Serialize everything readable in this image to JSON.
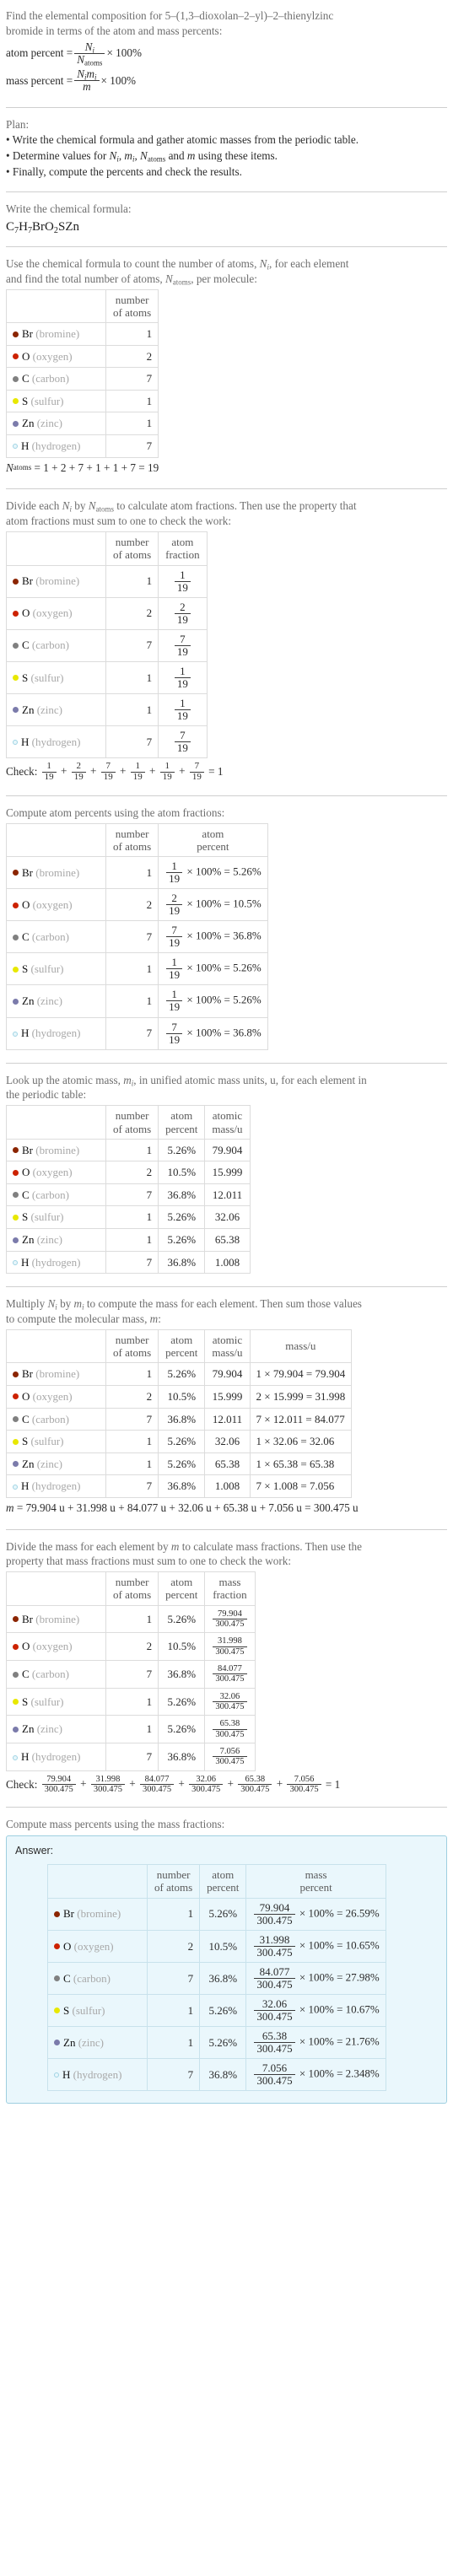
{
  "intro": {
    "line1": "Find the elemental composition for 5–(1,3–dioxolan–2–yl)–2–thienylzinc",
    "line2": "bromide in terms of the atom and mass percents:",
    "atom_percent_label": "atom percent =",
    "mass_percent_label": "mass percent =",
    "times100": "× 100%"
  },
  "plan": {
    "heading": "Plan:",
    "b1": "• Write the chemical formula and gather atomic masses from the periodic table.",
    "b2_pre": "• Determine values for ",
    "b2_post": " using these items.",
    "b3": "• Finally, compute the percents and check the results."
  },
  "formula_section": {
    "heading": "Write the chemical formula:",
    "formula": "C7H7BrO2SZn"
  },
  "count_section": {
    "line1": "Use the chemical formula to count the number of atoms, Ni, for each element",
    "line2": "and find the total number of atoms, Natoms, per molecule:",
    "headers": [
      "",
      "number of atoms"
    ],
    "total_line": "Natoms = 1 + 2 + 7 + 1 + 1 + 7 = 19",
    "total_sum": "1 + 2 + 7 + 1 + 1 + 7 = 19"
  },
  "fraction_section": {
    "line1": "Divide each Ni by Natoms to calculate atom fractions. Then use the property that",
    "line2": "atom fractions must sum to one to check the work:",
    "headers": [
      "",
      "number of atoms",
      "atom fraction"
    ],
    "check_label": "Check:",
    "check_result": "= 1"
  },
  "atom_percent_section": {
    "heading": "Compute atom percents using the atom fractions:",
    "headers": [
      "",
      "number of atoms",
      "atom percent"
    ]
  },
  "atomic_mass_section": {
    "line1": "Look up the atomic mass, mi, in unified atomic mass units, u, for each element in",
    "line2": "the periodic table:",
    "headers": [
      "",
      "number of atoms",
      "atom percent",
      "atomic mass/u"
    ]
  },
  "mass_section": {
    "line1": "Multiply Ni by mi to compute the mass for each element. Then sum those values",
    "line2": "to compute the molecular mass, m:",
    "headers": [
      "",
      "number of atoms",
      "atom percent",
      "atomic mass/u",
      "mass/u"
    ],
    "total_line": "m = 79.904 u + 31.998 u + 84.077 u + 32.06 u + 65.38 u + 7.056 u = 300.475 u"
  },
  "mass_fraction_section": {
    "line1": "Divide the mass for each element by m to calculate mass fractions. Then use the",
    "line2": "property that mass fractions must sum to one to check the work:",
    "headers": [
      "",
      "number of atoms",
      "atom percent",
      "mass fraction"
    ],
    "check_label": "Check:",
    "check_result": "= 1",
    "denominator": "300.475"
  },
  "mass_percent_section": {
    "heading": "Compute mass percents using the mass fractions:",
    "answer_label": "Answer:",
    "headers": [
      "",
      "number of atoms",
      "atom percent",
      "mass percent"
    ],
    "times100": "× 100%"
  },
  "total_atoms": "19",
  "molecular_mass": "300.475",
  "elements": [
    {
      "symbol": "Br",
      "name": "(bromine)",
      "color": "#8b2500",
      "hollow": false,
      "count": "1",
      "fraction_num": "1",
      "fraction_den": "19",
      "atom_percent": "5.26%",
      "atomic_mass": "79.904",
      "mass_expr": "1 × 79.904 = 79.904",
      "mass": "79.904",
      "mass_percent": "26.59%"
    },
    {
      "symbol": "O",
      "name": "(oxygen)",
      "color": "#cc2200",
      "hollow": false,
      "count": "2",
      "fraction_num": "2",
      "fraction_den": "19",
      "atom_percent": "10.5%",
      "atomic_mass": "15.999",
      "mass_expr": "2 × 15.999 = 31.998",
      "mass": "31.998",
      "mass_percent": "10.65%"
    },
    {
      "symbol": "C",
      "name": "(carbon)",
      "color": "#808080",
      "hollow": false,
      "count": "7",
      "fraction_num": "7",
      "fraction_den": "19",
      "atom_percent": "36.8%",
      "atomic_mass": "12.011",
      "mass_expr": "7 × 12.011 = 84.077",
      "mass": "84.077",
      "mass_percent": "27.98%"
    },
    {
      "symbol": "S",
      "name": "(sulfur)",
      "color": "#e8e800",
      "hollow": false,
      "count": "1",
      "fraction_num": "1",
      "fraction_den": "19",
      "atom_percent": "5.26%",
      "atomic_mass": "32.06",
      "mass_expr": "1 × 32.06 = 32.06",
      "mass": "32.06",
      "mass_percent": "10.67%"
    },
    {
      "symbol": "Zn",
      "name": "(zinc)",
      "color": "#7b7bab",
      "hollow": false,
      "count": "1",
      "fraction_num": "1",
      "fraction_den": "19",
      "atom_percent": "5.26%",
      "atomic_mass": "65.38",
      "mass_expr": "1 × 65.38 = 65.38",
      "mass": "65.38",
      "mass_percent": "21.76%"
    },
    {
      "symbol": "H",
      "name": "(hydrogen)",
      "color": "#ffffff",
      "hollow": true,
      "count": "7",
      "fraction_num": "7",
      "fraction_den": "19",
      "atom_percent": "36.8%",
      "atomic_mass": "1.008",
      "mass_expr": "7 × 1.008 = 7.056",
      "mass": "7.056",
      "mass_percent": "2.348%"
    }
  ]
}
